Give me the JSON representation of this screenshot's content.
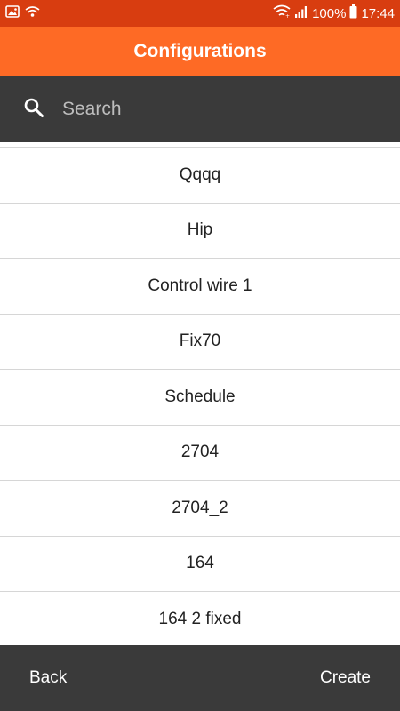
{
  "status_bar": {
    "battery": "100%",
    "time": "17:44",
    "icons": [
      "gallery-icon",
      "wifi-call-icon",
      "wifi-icon",
      "signal-icon",
      "battery-icon"
    ]
  },
  "header": {
    "title": "Configurations"
  },
  "search": {
    "placeholder": "Search",
    "value": ""
  },
  "list": {
    "items": [
      {
        "label": "Qqqq"
      },
      {
        "label": "Hip"
      },
      {
        "label": "Control wire 1"
      },
      {
        "label": "Fix70"
      },
      {
        "label": "Schedule"
      },
      {
        "label": "2704"
      },
      {
        "label": "2704_2"
      },
      {
        "label": "164"
      },
      {
        "label": "164 2 fixed"
      }
    ]
  },
  "footer": {
    "back_label": "Back",
    "create_label": "Create"
  },
  "colors": {
    "status_bar": "#d83d10",
    "app_bar": "#fe6a25",
    "dark_bar": "#3a3a3a",
    "divider": "#d6d6d6"
  }
}
